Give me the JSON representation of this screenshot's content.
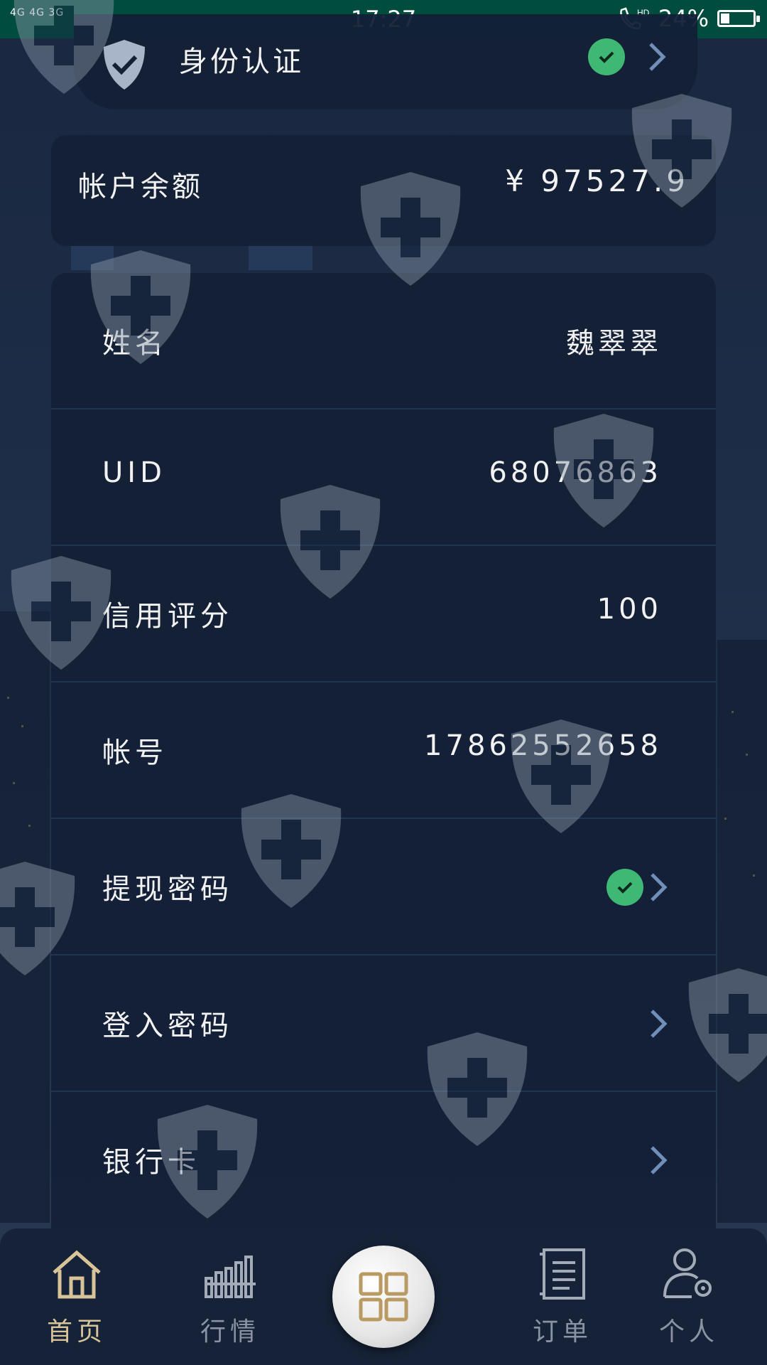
{
  "status_bar": {
    "signal_text": "4G 4G 3G",
    "time": "17:27",
    "battery_text": "24%",
    "battery_level": 0.24,
    "call_icon": "hd-call-icon"
  },
  "identity": {
    "label": "身份认证",
    "verified": true
  },
  "balance": {
    "label": "帐户余额",
    "value": "¥ 97527.9"
  },
  "profile_rows": [
    {
      "label": "姓名",
      "value": "魏翠翠"
    },
    {
      "label": "UID",
      "value": "68076863"
    },
    {
      "label": "信用评分",
      "value": "100"
    },
    {
      "label": "帐号",
      "value": "17862552658"
    },
    {
      "label": "提现密码",
      "value": "",
      "verified": true,
      "has_chevron": true
    },
    {
      "label": "登入密码",
      "value": "",
      "has_chevron": true
    },
    {
      "label": "银行卡",
      "value": "",
      "has_chevron": true
    }
  ],
  "tabs": [
    {
      "label": "首页",
      "icon": "home-icon",
      "active": true
    },
    {
      "label": "行情",
      "icon": "market-chart-icon",
      "active": false
    },
    {
      "label": "",
      "icon": "grid-menu-icon",
      "active": false
    },
    {
      "label": "订单",
      "icon": "order-list-icon",
      "active": false
    },
    {
      "label": "个人",
      "icon": "user-settings-icon",
      "active": false
    }
  ],
  "colors": {
    "status_bar": "#004d40",
    "card": "#132036",
    "check_green": "#3fb873",
    "active_tab": "#d9c49a",
    "chevron": "#6f8fb8"
  }
}
